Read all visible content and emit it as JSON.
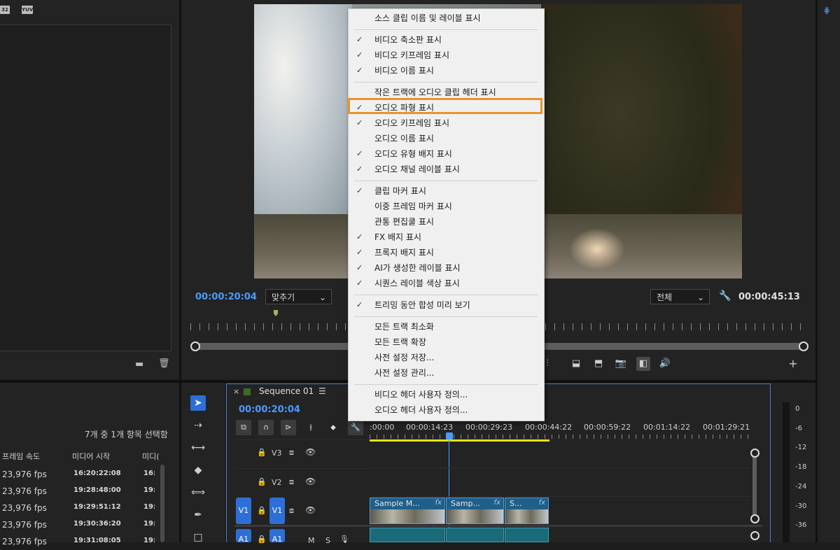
{
  "project_panel": {
    "badges": [
      "32",
      "YUV"
    ],
    "bottom_icons": [
      "folder-icon",
      "trash-icon"
    ]
  },
  "source_info": {
    "selection_text": "7개 중 1개 항목 선택함",
    "columns": [
      "프레임 속도",
      "미디어 시작",
      "미디("
    ],
    "rows": [
      {
        "fps": "23,976 fps",
        "start": "16:20:22:08",
        "end": "16:"
      },
      {
        "fps": "23,976 fps",
        "start": "19:28:48:00",
        "end": "19:"
      },
      {
        "fps": "23,976 fps",
        "start": "19:29:51:12",
        "end": "19:"
      },
      {
        "fps": "23,976 fps",
        "start": "19:30:36:20",
        "end": "19:"
      },
      {
        "fps": "23,976 fps",
        "start": "19:31:08:05",
        "end": "19:"
      }
    ]
  },
  "program_monitor": {
    "timecode_current": "00:00:20:04",
    "zoom_select": "맞추기",
    "quality_select": "전체",
    "timecode_duration": "00:00:45:13"
  },
  "context_menu": {
    "items": [
      {
        "label": "소스 클립 이름 및 레이블 표시",
        "checked": false
      },
      {
        "label": "비디오 축소판 표시",
        "checked": true
      },
      {
        "label": "비디오 키프레임 표시",
        "checked": true
      },
      {
        "label": "비디오 이름 표시",
        "checked": true
      },
      {
        "label": "작은 트랙에 오디오 클립 헤더 표시",
        "checked": false
      },
      {
        "label": "오디오 파형 표시",
        "checked": true
      },
      {
        "label": "오디오 키프레임 표시",
        "checked": true
      },
      {
        "label": "오디오 이름 표시",
        "checked": false
      },
      {
        "label": "오디오 유형 배지 표시",
        "checked": true
      },
      {
        "label": "오디오 채널 레이블 표시",
        "checked": true
      },
      {
        "label": "클립 마커 표시",
        "checked": true
      },
      {
        "label": "이중 프레임 마커 표시",
        "checked": false
      },
      {
        "label": "관통 편집쿨 표시",
        "checked": false
      },
      {
        "label": "FX 배지 표시",
        "checked": true
      },
      {
        "label": "프록지 배지 표시",
        "checked": true
      },
      {
        "label": "AI가 생성한 레이블 표시",
        "checked": true
      },
      {
        "label": "시퀀스 레이블 색상 표시",
        "checked": true
      },
      {
        "label": "트리밍 동안 합성 미리 보기",
        "checked": true
      },
      {
        "label": "모든 트랙 최소화",
        "checked": false
      },
      {
        "label": "모든 트랙 확장",
        "checked": false
      },
      {
        "label": "사전 설정 저장...",
        "checked": false
      },
      {
        "label": "사전 설정 관리...",
        "checked": false
      },
      {
        "label": "비디오 헤더 사용자 정의...",
        "checked": false
      },
      {
        "label": "오디오 헤더 사용자 정의...",
        "checked": false
      }
    ],
    "check_glyph": "✓"
  },
  "timeline": {
    "close": "×",
    "sequence_name": "Sequence 01",
    "menu_glyph": "☰",
    "timecode": "00:00:20:04",
    "ruler_ticks": [
      ":00:00",
      "00:00:14:23",
      "00:00:29:23",
      "00:00:44:22",
      "00:00:59:22",
      "00:01:14:22",
      "00:01:29:21"
    ],
    "tracks": {
      "v3": "V3",
      "v2": "V2",
      "v1": "V1",
      "v1_target": "V1",
      "a1": "A1",
      "a1_target": "A1",
      "m": "M",
      "s": "S"
    },
    "clips": [
      "Sample M...",
      "Samp...",
      "S..."
    ],
    "fx_label": "fx"
  },
  "audio_meter": {
    "labels": [
      "0",
      "-6",
      "-12",
      "-18",
      "-24",
      "-30",
      "-36"
    ]
  },
  "colors": {
    "accent_blue": "#2d6fd6",
    "timecode_blue": "#4a9bff",
    "highlight_orange": "#e8932a",
    "playhead": "#4a9bff",
    "work_area": "#e6e600"
  }
}
